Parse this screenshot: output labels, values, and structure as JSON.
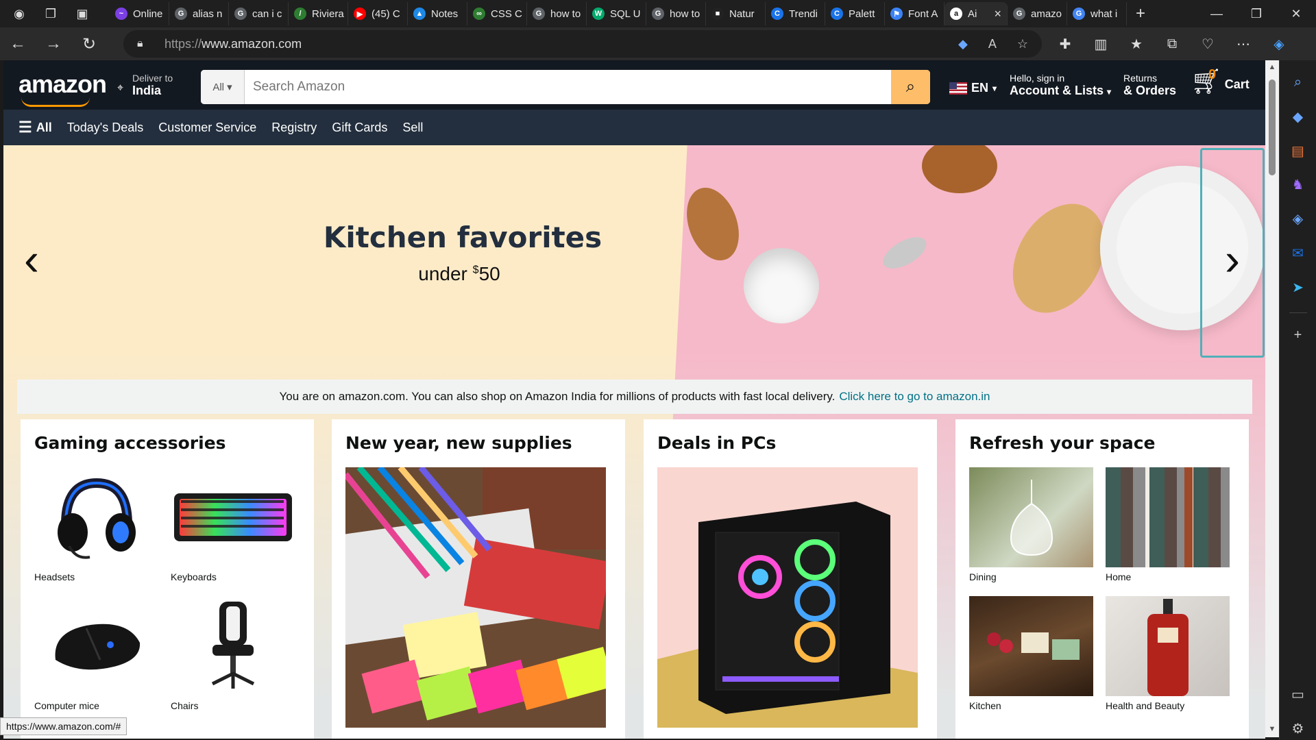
{
  "browser": {
    "tabs": [
      {
        "label": "Online",
        "color": "#7b3fe4",
        "glyph": "~"
      },
      {
        "label": "alias n",
        "color": "#5f6368",
        "glyph": "G"
      },
      {
        "label": "can i c",
        "color": "#5f6368",
        "glyph": "G"
      },
      {
        "label": "Riviera",
        "color": "#2e7d32",
        "glyph": "/"
      },
      {
        "label": "(45) C",
        "color": "#ff0000",
        "glyph": "▶"
      },
      {
        "label": "Notes",
        "color": "#1e88e5",
        "glyph": "▲"
      },
      {
        "label": "CSS C",
        "color": "#2e7d32",
        "glyph": "∞"
      },
      {
        "label": "how to",
        "color": "#5f6368",
        "glyph": "G"
      },
      {
        "label": "SQL U",
        "color": "#04aa6d",
        "glyph": "W"
      },
      {
        "label": "how to",
        "color": "#5f6368",
        "glyph": "G"
      },
      {
        "label": "Natur",
        "color": "#222222",
        "glyph": "■"
      },
      {
        "label": "Trendi",
        "color": "#1a73e8",
        "glyph": "C"
      },
      {
        "label": "Palett",
        "color": "#1a73e8",
        "glyph": "C"
      },
      {
        "label": "Font A",
        "color": "#3b82f6",
        "glyph": "⚑"
      },
      {
        "label": "Ai",
        "color": "#ffffff",
        "glyph": "a",
        "active": true
      },
      {
        "label": "amazo",
        "color": "#5f6368",
        "glyph": "G"
      },
      {
        "label": "what i",
        "color": "#4285f4",
        "glyph": "G"
      }
    ],
    "url_protocol": "https://",
    "url_host": "www.amazon.com",
    "status_url": "https://www.amazon.com/#"
  },
  "header": {
    "logo": "amazon",
    "deliver_small": "Deliver to",
    "deliver_big": "India",
    "search_category": "All",
    "search_placeholder": "Search Amazon",
    "language": "EN",
    "account_small": "Hello, sign in",
    "account_big": "Account & Lists",
    "orders_small": "Returns",
    "orders_big": "& Orders",
    "cart_count": "0",
    "cart_label": "Cart"
  },
  "subnav": {
    "all": "All",
    "items": [
      "Today's Deals",
      "Customer Service",
      "Registry",
      "Gift Cards",
      "Sell"
    ]
  },
  "hero": {
    "title": "Kitchen favorites",
    "sub_prefix": "under ",
    "sub_currency": "$",
    "sub_amount": "50"
  },
  "notice": {
    "text": "You are on amazon.com. You can also shop on Amazon India for millions of products with fast local delivery.",
    "link": "Click here to go to amazon.in"
  },
  "cards": [
    {
      "title": "Gaming accessories",
      "items": [
        "Headsets",
        "Keyboards",
        "Computer mice",
        "Chairs"
      ]
    },
    {
      "title": "New year, new supplies"
    },
    {
      "title": "Deals in PCs"
    },
    {
      "title": "Refresh your space",
      "items": [
        "Dining",
        "Home",
        "Kitchen",
        "Health and Beauty"
      ]
    }
  ],
  "colors": {
    "header_bg": "#131921",
    "subnav_bg": "#232f3e",
    "search_button": "#febd69",
    "link": "#007185",
    "cart_count": "#f08804"
  }
}
